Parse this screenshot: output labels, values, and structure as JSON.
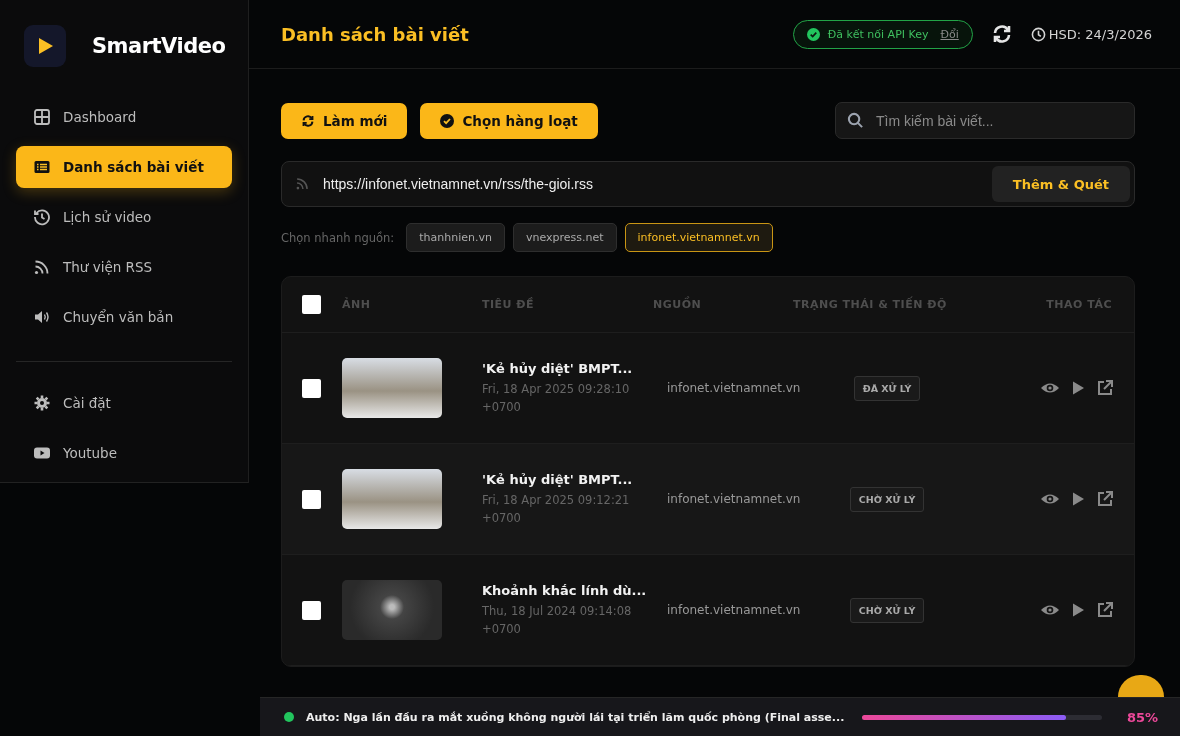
{
  "brand": {
    "name": "SmartVideo"
  },
  "sidebar": {
    "items": [
      {
        "label": "Dashboard",
        "selected": false
      },
      {
        "label": "Danh sách bài viết",
        "selected": true
      },
      {
        "label": "Lịch sử video",
        "selected": false
      },
      {
        "label": "Thư viện RSS",
        "selected": false
      },
      {
        "label": "Chuyển văn bản",
        "selected": false
      }
    ],
    "bottom_items": [
      {
        "label": "Cài đặt",
        "selected": false
      },
      {
        "label": "Youtube",
        "selected": false
      }
    ]
  },
  "header": {
    "title": "Danh sách bài viết",
    "api_status": "Đã kết nối API Key",
    "api_link": "Đổi",
    "expiry": "HSD: 24/3/2026"
  },
  "toolbar": {
    "buttons": [
      {
        "label": "Làm mới"
      },
      {
        "label": "Chọn hàng loạt"
      }
    ],
    "search": {
      "placeholder": "Tìm kiếm bài viết..."
    }
  },
  "rss_input": {
    "value": "https://infonet.vietnamnet.vn/rss/the-gioi.rss",
    "button": "Thêm & Quét"
  },
  "quick_sources": {
    "label": "Chọn nhanh nguồn:",
    "items": [
      {
        "label": "thanhnien.vn",
        "selected": false
      },
      {
        "label": "vnexpress.net",
        "selected": false
      },
      {
        "label": "infonet.vietnamnet.vn",
        "selected": true
      }
    ]
  },
  "table": {
    "select_all": {
      "checked": false
    },
    "columns": [
      "ẢNH",
      "TIÊU ĐỀ",
      "NGUỒN",
      "TRẠNG THÁI & TIẾN ĐỘ",
      "THAO TÁC"
    ],
    "rows": [
      {
        "checked": false,
        "title": "'Kẻ hủy diệt' BMPT...",
        "date": "Fri, 18 Apr 2025 09:28:10 +0700",
        "source": "infonet.vietnamnet.vn",
        "status": "ĐÃ XỬ LÝ"
      },
      {
        "checked": false,
        "title": "'Kẻ hủy diệt' BMPT...",
        "date": "Fri, 18 Apr 2025 09:12:21 +0700",
        "source": "infonet.vietnamnet.vn",
        "status": "CHỜ XỬ LÝ"
      },
      {
        "checked": false,
        "title": "Khoảnh khắc lính dù...",
        "date": "Thu, 18 Jul 2024 09:14:08 +0700",
        "source": "infonet.vietnamnet.vn",
        "status": "CHỜ XỬ LÝ"
      }
    ]
  },
  "progress_bar": {
    "text": "Auto: Nga lần đầu ra mắt xuồng không người lái tại triển lãm quốc phòng (Final asse...",
    "level": 0.85,
    "reading": "85%"
  }
}
